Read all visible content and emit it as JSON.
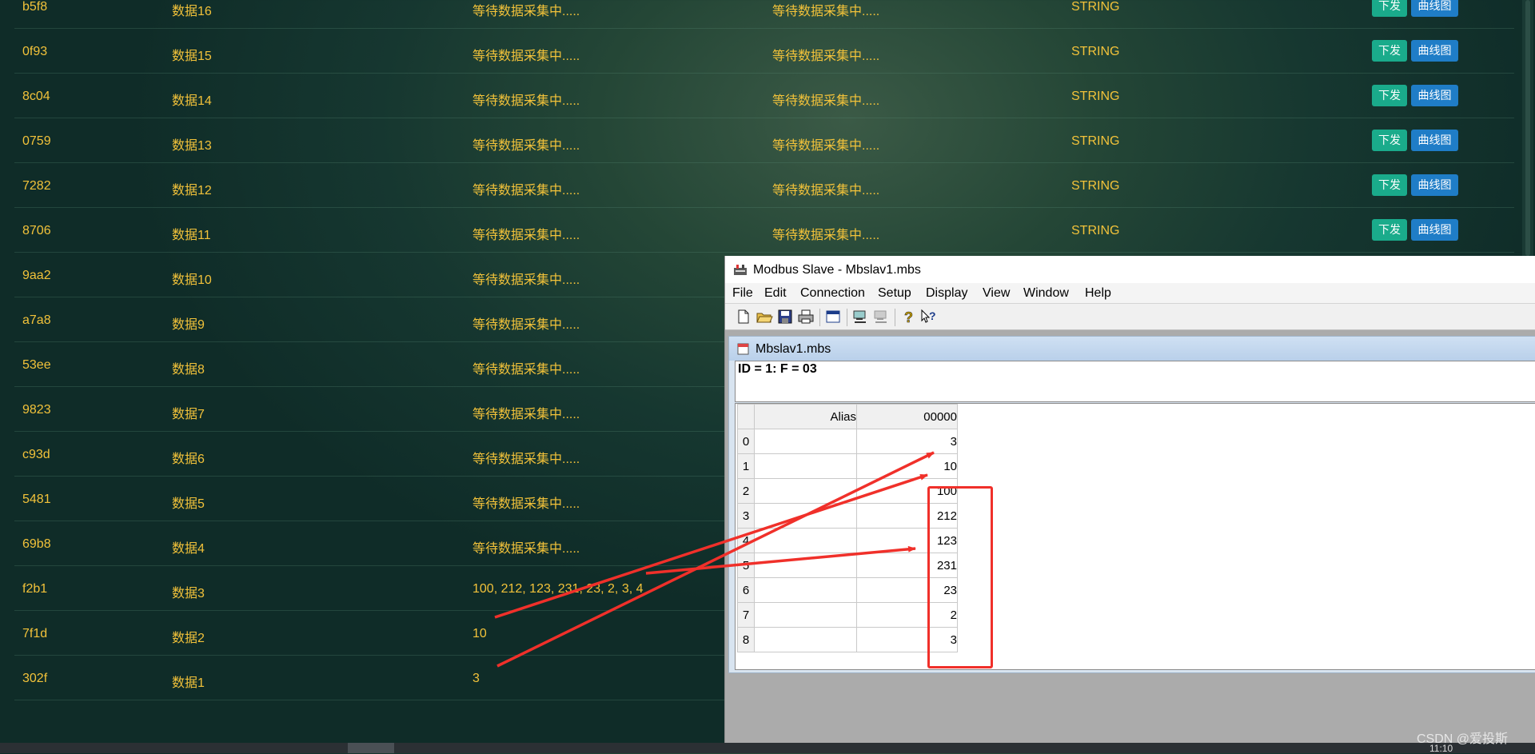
{
  "table": {
    "rows": [
      {
        "id": "b5f8",
        "name": "数据16",
        "value": "等待数据采集中.....",
        "value2": "等待数据采集中.....",
        "type": "STRING",
        "send": "下发",
        "chart": "曲线图"
      },
      {
        "id": "0f93",
        "name": "数据15",
        "value": "等待数据采集中.....",
        "value2": "等待数据采集中.....",
        "type": "STRING",
        "send": "下发",
        "chart": "曲线图"
      },
      {
        "id": "8c04",
        "name": "数据14",
        "value": "等待数据采集中.....",
        "value2": "等待数据采集中.....",
        "type": "STRING",
        "send": "下发",
        "chart": "曲线图"
      },
      {
        "id": "0759",
        "name": "数据13",
        "value": "等待数据采集中.....",
        "value2": "等待数据采集中.....",
        "type": "STRING",
        "send": "下发",
        "chart": "曲线图"
      },
      {
        "id": "7282",
        "name": "数据12",
        "value": "等待数据采集中.....",
        "value2": "等待数据采集中.....",
        "type": "STRING",
        "send": "下发",
        "chart": "曲线图"
      },
      {
        "id": "8706",
        "name": "数据11",
        "value": "等待数据采集中.....",
        "value2": "等待数据采集中.....",
        "type": "STRING",
        "send": "下发",
        "chart": "曲线图"
      },
      {
        "id": "9aa2",
        "name": "数据10",
        "value": "等待数据采集中....."
      },
      {
        "id": "a7a8",
        "name": "数据9",
        "value": "等待数据采集中....."
      },
      {
        "id": "53ee",
        "name": "数据8",
        "value": "等待数据采集中....."
      },
      {
        "id": "9823",
        "name": "数据7",
        "value": "等待数据采集中....."
      },
      {
        "id": "c93d",
        "name": "数据6",
        "value": "等待数据采集中....."
      },
      {
        "id": "5481",
        "name": "数据5",
        "value": "等待数据采集中....."
      },
      {
        "id": "69b8",
        "name": "数据4",
        "value": "等待数据采集中....."
      },
      {
        "id": "f2b1",
        "name": "数据3",
        "value": "100, 212, 123, 231, 23, 2, 3, 4"
      },
      {
        "id": "7f1d",
        "name": "数据2",
        "value": "10"
      },
      {
        "id": "302f",
        "name": "数据1",
        "value": "3"
      }
    ]
  },
  "modbus": {
    "window_title": "Modbus Slave - Mbslav1.mbs",
    "menu": [
      "File",
      "Edit",
      "Connection",
      "Setup",
      "Display",
      "View",
      "Window",
      "Help"
    ],
    "toolbar_icons": [
      "new-file-icon",
      "open-folder-icon",
      "save-icon",
      "print-icon",
      "window-icon",
      "connect-icon",
      "disconnect-icon",
      "help-icon",
      "context-help-icon"
    ],
    "doc_title": "Mbslav1.mbs",
    "header": "ID = 1: F = 03",
    "grid": {
      "alias_header": "Alias",
      "col_header": "00000",
      "rows": [
        {
          "row": "0",
          "value": "3"
        },
        {
          "row": "1",
          "value": "10"
        },
        {
          "row": "2",
          "value": "100"
        },
        {
          "row": "3",
          "value": "212"
        },
        {
          "row": "4",
          "value": "123"
        },
        {
          "row": "5",
          "value": "231"
        },
        {
          "row": "6",
          "value": "23"
        },
        {
          "row": "7",
          "value": "2"
        },
        {
          "row": "8",
          "value": "3"
        }
      ]
    }
  },
  "annotation_color": "#f0302a",
  "taskbar": {
    "clock": "11:10"
  },
  "watermark": "CSDN @爱投斯"
}
